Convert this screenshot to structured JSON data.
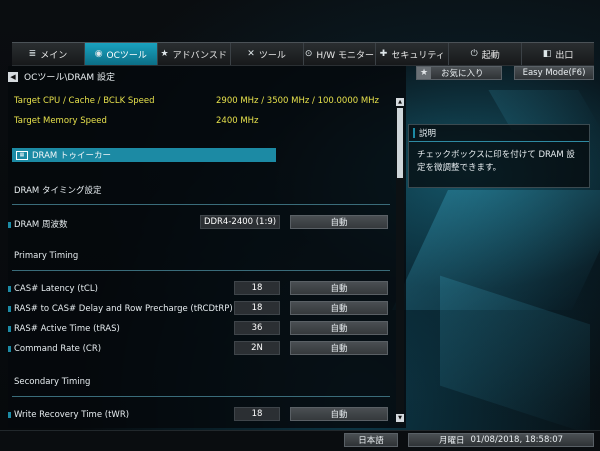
{
  "nav": {
    "tabs": [
      {
        "icon": "≣",
        "label": "メイン",
        "active": false
      },
      {
        "icon": "◉",
        "label": "OCツール",
        "active": true
      },
      {
        "icon": "★",
        "label": "アドバンスド",
        "active": false
      },
      {
        "icon": "✕",
        "label": "ツール",
        "active": false
      },
      {
        "icon": "⊙",
        "label": "H/W モニター",
        "active": false
      },
      {
        "icon": "✚",
        "label": "セキュリティ",
        "active": false
      },
      {
        "icon": "⏻",
        "label": "起動",
        "active": false
      },
      {
        "icon": "◧",
        "label": "出口",
        "active": false
      }
    ]
  },
  "breadcrumb": "OCツール\\DRAM 設定",
  "info": {
    "cpu_label": "Target CPU / Cache / BCLK Speed",
    "cpu_value": "2900 MHz / 3500 MHz / 100.0000 MHz",
    "mem_label": "Target Memory Speed",
    "mem_value": "2400 MHz"
  },
  "tweaker_label": "DRAM トゥイーカー",
  "sections": {
    "timing": "DRAM タイミング設定",
    "primary": "Primary Timing",
    "secondary": "Secondary Timing"
  },
  "settings": {
    "freq": {
      "label": "DRAM 周波数",
      "value": "DDR4-2400 (1:9)",
      "option": "自動"
    },
    "cl": {
      "label": "CAS# Latency (tCL)",
      "value": "18",
      "option": "自動"
    },
    "rcd": {
      "label": "RAS# to CAS# Delay and Row Precharge (tRCDtRP)",
      "value": "18",
      "option": "自動"
    },
    "ras": {
      "label": "RAS# Active Time (tRAS)",
      "value": "36",
      "option": "自動"
    },
    "cr": {
      "label": "Command Rate (CR)",
      "value": "2N",
      "option": "自動"
    },
    "twr": {
      "label": "Write Recovery Time (tWR)",
      "value": "18",
      "option": "自動"
    }
  },
  "right": {
    "favorite": "お気に入り",
    "easy_mode": "Easy Mode(F6)",
    "desc_title": "説明",
    "desc_text": "チェックボックスに印を付けて DRAM 設定を微調整できます。"
  },
  "footer": {
    "language": "日本語",
    "date_label": "月曜日",
    "datetime": "01/08/2018, 18:58:07"
  },
  "colors": {
    "accent": "#1c8aa4",
    "highlight_text": "#e6e04c"
  }
}
